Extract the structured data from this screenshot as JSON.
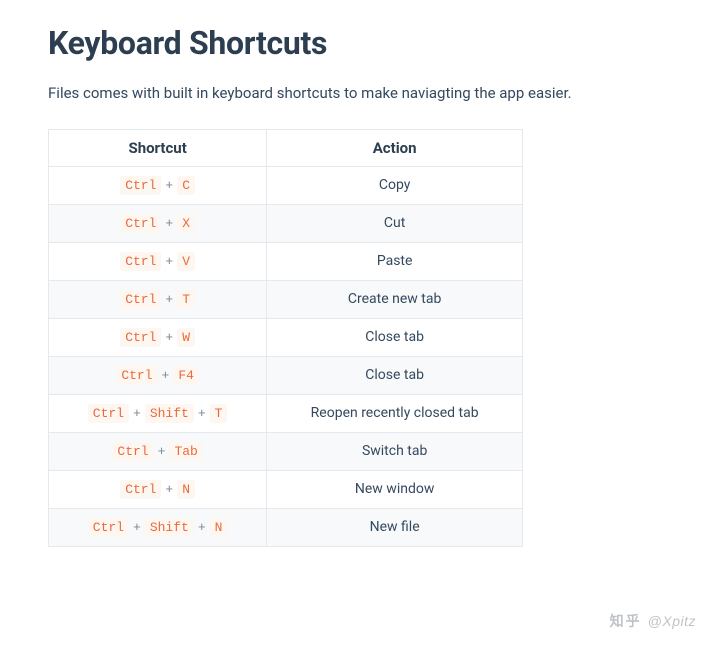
{
  "page": {
    "title": "Keyboard Shortcuts",
    "intro": "Files comes with built in keyboard shortcuts to make naviagting the app easier."
  },
  "table": {
    "headers": {
      "shortcut": "Shortcut",
      "action": "Action"
    },
    "separator": "+",
    "rows": [
      {
        "keys": [
          "Ctrl",
          "C"
        ],
        "action": "Copy"
      },
      {
        "keys": [
          "Ctrl",
          "X"
        ],
        "action": "Cut"
      },
      {
        "keys": [
          "Ctrl",
          "V"
        ],
        "action": "Paste"
      },
      {
        "keys": [
          "Ctrl",
          "T"
        ],
        "action": "Create new tab"
      },
      {
        "keys": [
          "Ctrl",
          "W"
        ],
        "action": "Close tab"
      },
      {
        "keys": [
          "Ctrl",
          "F4"
        ],
        "action": "Close tab"
      },
      {
        "keys": [
          "Ctrl",
          "Shift",
          "T"
        ],
        "action": "Reopen recently closed tab"
      },
      {
        "keys": [
          "Ctrl",
          "Tab"
        ],
        "action": "Switch tab"
      },
      {
        "keys": [
          "Ctrl",
          "N"
        ],
        "action": "New window"
      },
      {
        "keys": [
          "Ctrl",
          "Shift",
          "N"
        ],
        "action": "New file"
      }
    ]
  },
  "watermark": {
    "logo": "知乎",
    "text": "@Xpitz"
  }
}
